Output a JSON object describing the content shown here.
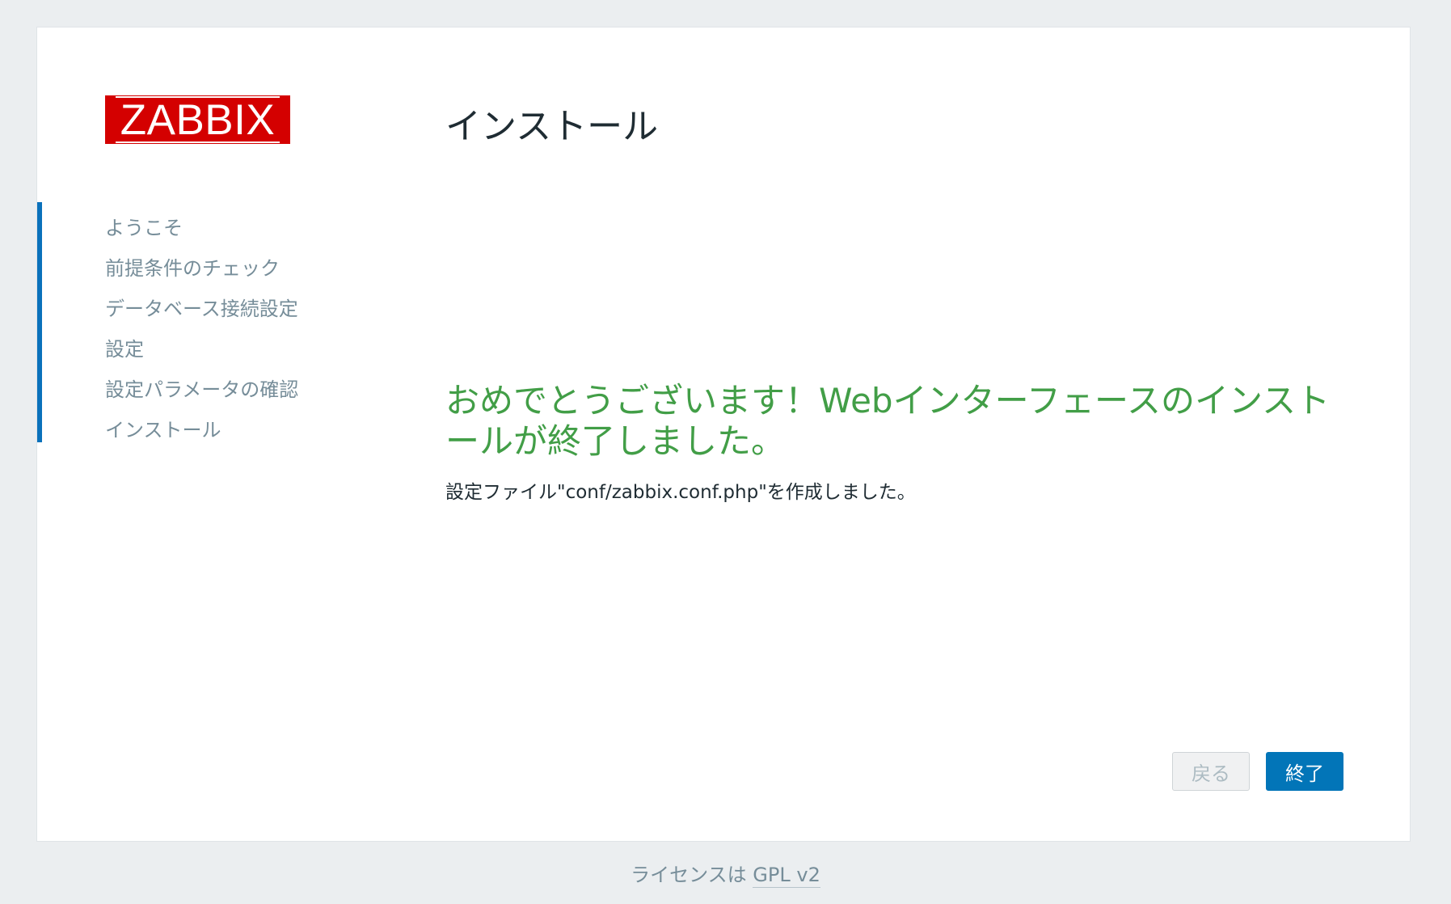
{
  "brand": {
    "logo_text": "ZABBIX",
    "logo_color": "#d40000"
  },
  "sidebar": {
    "steps": [
      {
        "label": "ようこそ"
      },
      {
        "label": "前提条件のチェック"
      },
      {
        "label": "データベース接続設定"
      },
      {
        "label": "設定"
      },
      {
        "label": "設定パラメータの確認"
      },
      {
        "label": "インストール"
      }
    ],
    "progress_bar_color": "#0a71bb"
  },
  "main": {
    "title": "インストール",
    "success_message": "おめでとうございます！Webインターフェースのインストールが終了しました。",
    "success_color": "#429e47",
    "config_message": "設定ファイル\"conf/zabbix.conf.php\"を作成しました。"
  },
  "buttons": {
    "back_label": "戻る",
    "back_disabled": true,
    "finish_label": "終了",
    "finish_color": "#0275b8"
  },
  "footer": {
    "license_prefix": "ライセンスは ",
    "license_link": "GPL v2"
  }
}
